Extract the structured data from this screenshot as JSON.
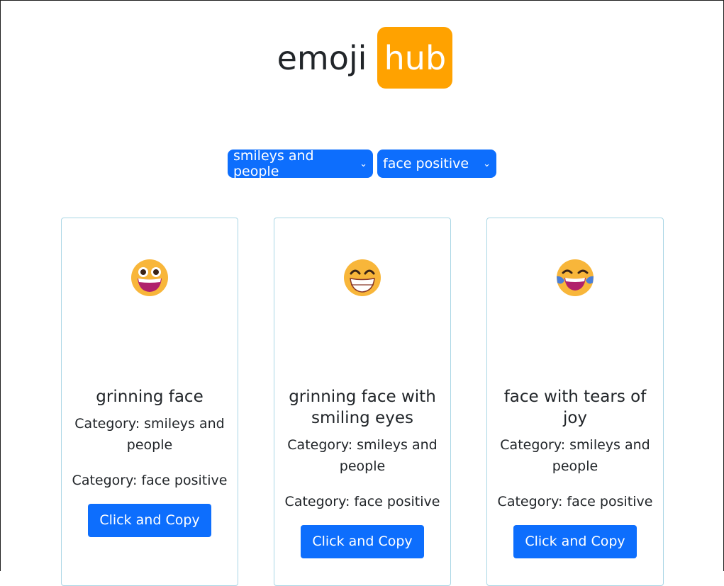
{
  "logo": {
    "word": "emoji",
    "badge": "hub"
  },
  "filters": {
    "category": {
      "selected": "smileys and people"
    },
    "group": {
      "selected": "face positive"
    }
  },
  "cards": [
    {
      "emoji_icon": "grinning-face-icon",
      "name": "grinning face",
      "category": "Category: smileys and people",
      "group": "Category: face positive",
      "button": "Click and Copy"
    },
    {
      "emoji_icon": "grinning-face-with-smiling-eyes-icon",
      "name": "grinning face with smiling eyes",
      "category": "Category: smileys and people",
      "group": "Category: face positive",
      "button": "Click and Copy"
    },
    {
      "emoji_icon": "face-with-tears-of-joy-icon",
      "name": "face with tears of joy",
      "category": "Category: smileys and people",
      "group": "Category: face positive",
      "button": "Click and Copy"
    }
  ],
  "colors": {
    "accent": "#0d6efd",
    "badge": "#ffa200",
    "card_border": "#a9d6e5"
  }
}
